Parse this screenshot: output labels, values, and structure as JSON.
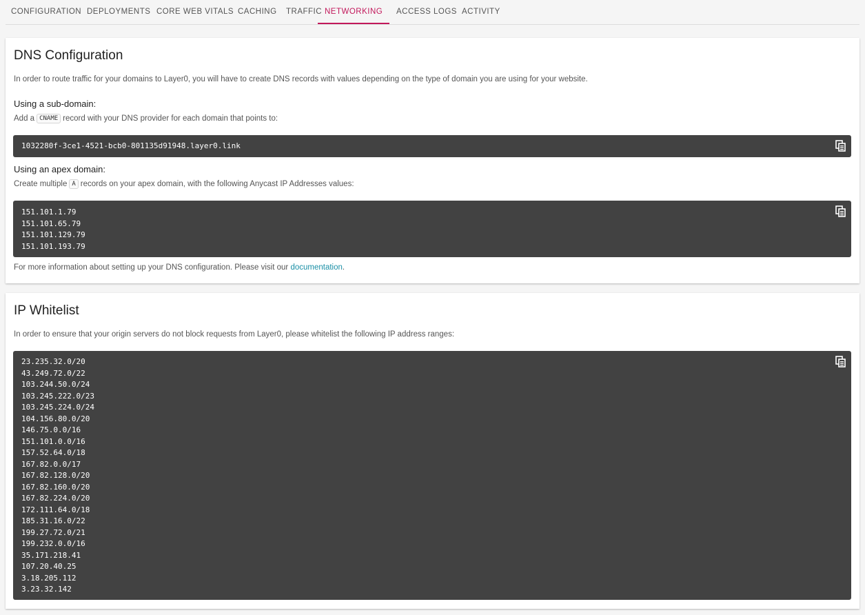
{
  "tabs": [
    {
      "label": "CONFIGURATION"
    },
    {
      "label": "DEPLOYMENTS"
    },
    {
      "label": "CORE WEB VITALS"
    },
    {
      "label": "CACHING"
    },
    {
      "label": "TRAFFIC"
    },
    {
      "label": "NETWORKING",
      "active": true
    },
    {
      "label": "ACCESS LOGS"
    },
    {
      "label": "ACTIVITY"
    }
  ],
  "dns": {
    "title": "DNS Configuration",
    "intro": "In order to route traffic for your domains to Layer0, you will have to create DNS records with values depending on the type of domain you are using for your website.",
    "subdomain_heading": "Using a sub-domain:",
    "subdomain_text_before": "Add a",
    "subdomain_code": "CNAME",
    "subdomain_text_after": "record with your DNS provider for each domain that points to:",
    "cname_value": "1032280f-3ce1-4521-bcb0-801135d91948.layer0.link",
    "apex_heading": "Using an apex domain:",
    "apex_text_before": "Create multiple",
    "apex_code": "A",
    "apex_text_after": "records on your apex domain, with the following Anycast IP Addresses values:",
    "apex_ips": [
      "151.101.1.79",
      "151.101.65.79",
      "151.101.129.79",
      "151.101.193.79"
    ],
    "footer_text": "For more information about setting up your DNS configuration. Please visit our",
    "footer_link": "documentation",
    "footer_period": "."
  },
  "whitelist": {
    "title": "IP Whitelist",
    "intro": "In order to ensure that your origin servers do not block requests from Layer0, please whitelist the following IP address ranges:",
    "ranges": [
      "23.235.32.0/20",
      "43.249.72.0/22",
      "103.244.50.0/24",
      "103.245.222.0/23",
      "103.245.224.0/24",
      "104.156.80.0/20",
      "146.75.0.0/16",
      "151.101.0.0/16",
      "157.52.64.0/18",
      "167.82.0.0/17",
      "167.82.128.0/20",
      "167.82.160.0/20",
      "167.82.224.0/20",
      "172.111.64.0/18",
      "185.31.16.0/22",
      "199.27.72.0/21",
      "199.232.0.0/16",
      "35.171.218.41",
      "107.20.40.25",
      "3.18.205.112",
      "3.23.32.142"
    ]
  },
  "icons": {
    "copy": "copy-icon"
  },
  "colors": {
    "accent": "#c2185b",
    "code_bg": "#424242",
    "link": "#1a8fa6"
  }
}
